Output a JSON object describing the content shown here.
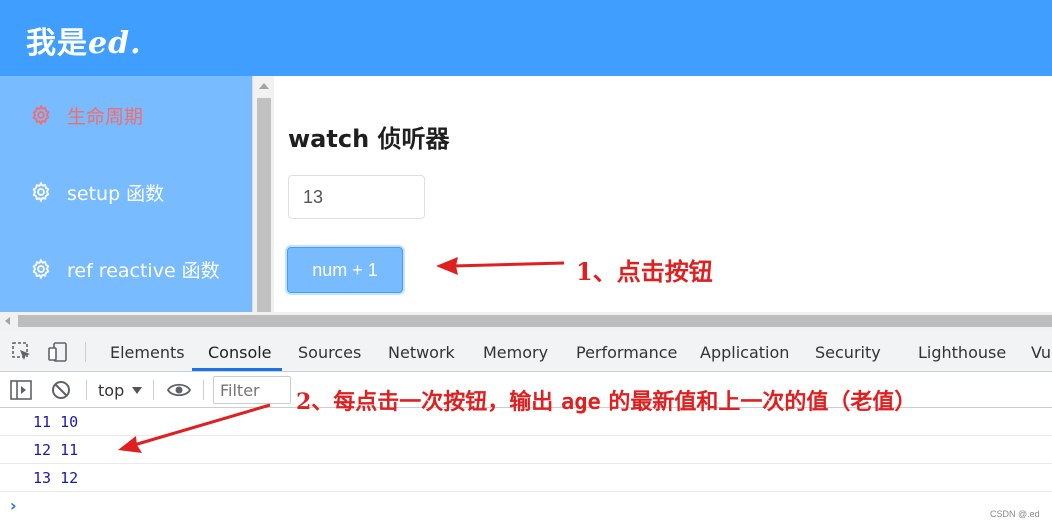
{
  "header": {
    "brand_prefix": "我是",
    "brand_suffix": "ed."
  },
  "sidebar": {
    "items": [
      {
        "label": "生命周期",
        "active": true
      },
      {
        "label": "setup 函数",
        "active": false
      },
      {
        "label": "ref reactive 函数",
        "active": false
      }
    ]
  },
  "main": {
    "title": "watch 侦听器",
    "input_value": "13",
    "button_label": "num + 1"
  },
  "annotations": {
    "step1": "1、点击按钮",
    "step2_before": "2、每点击一次按钮，输出 ",
    "step2_code": "age",
    "step2_after": " 的最新值和上一次的值（老值）"
  },
  "devtools": {
    "tabs": [
      "Elements",
      "Console",
      "Sources",
      "Network",
      "Memory",
      "Performance",
      "Application",
      "Security",
      "Lighthouse",
      "Vu"
    ],
    "active_tab": "Console",
    "context": "top",
    "filter_placeholder": "Filter",
    "logs": [
      "11 10",
      "12 11",
      "13 12"
    ],
    "prompt": "›"
  },
  "watermark": "CSDN @.ed",
  "colors": {
    "header": "#409eff",
    "sidebar": "#79bbff",
    "active_menu": "#f56c6c",
    "annotation": "#e02020",
    "devtools_tab_accent": "#1a73e8"
  }
}
